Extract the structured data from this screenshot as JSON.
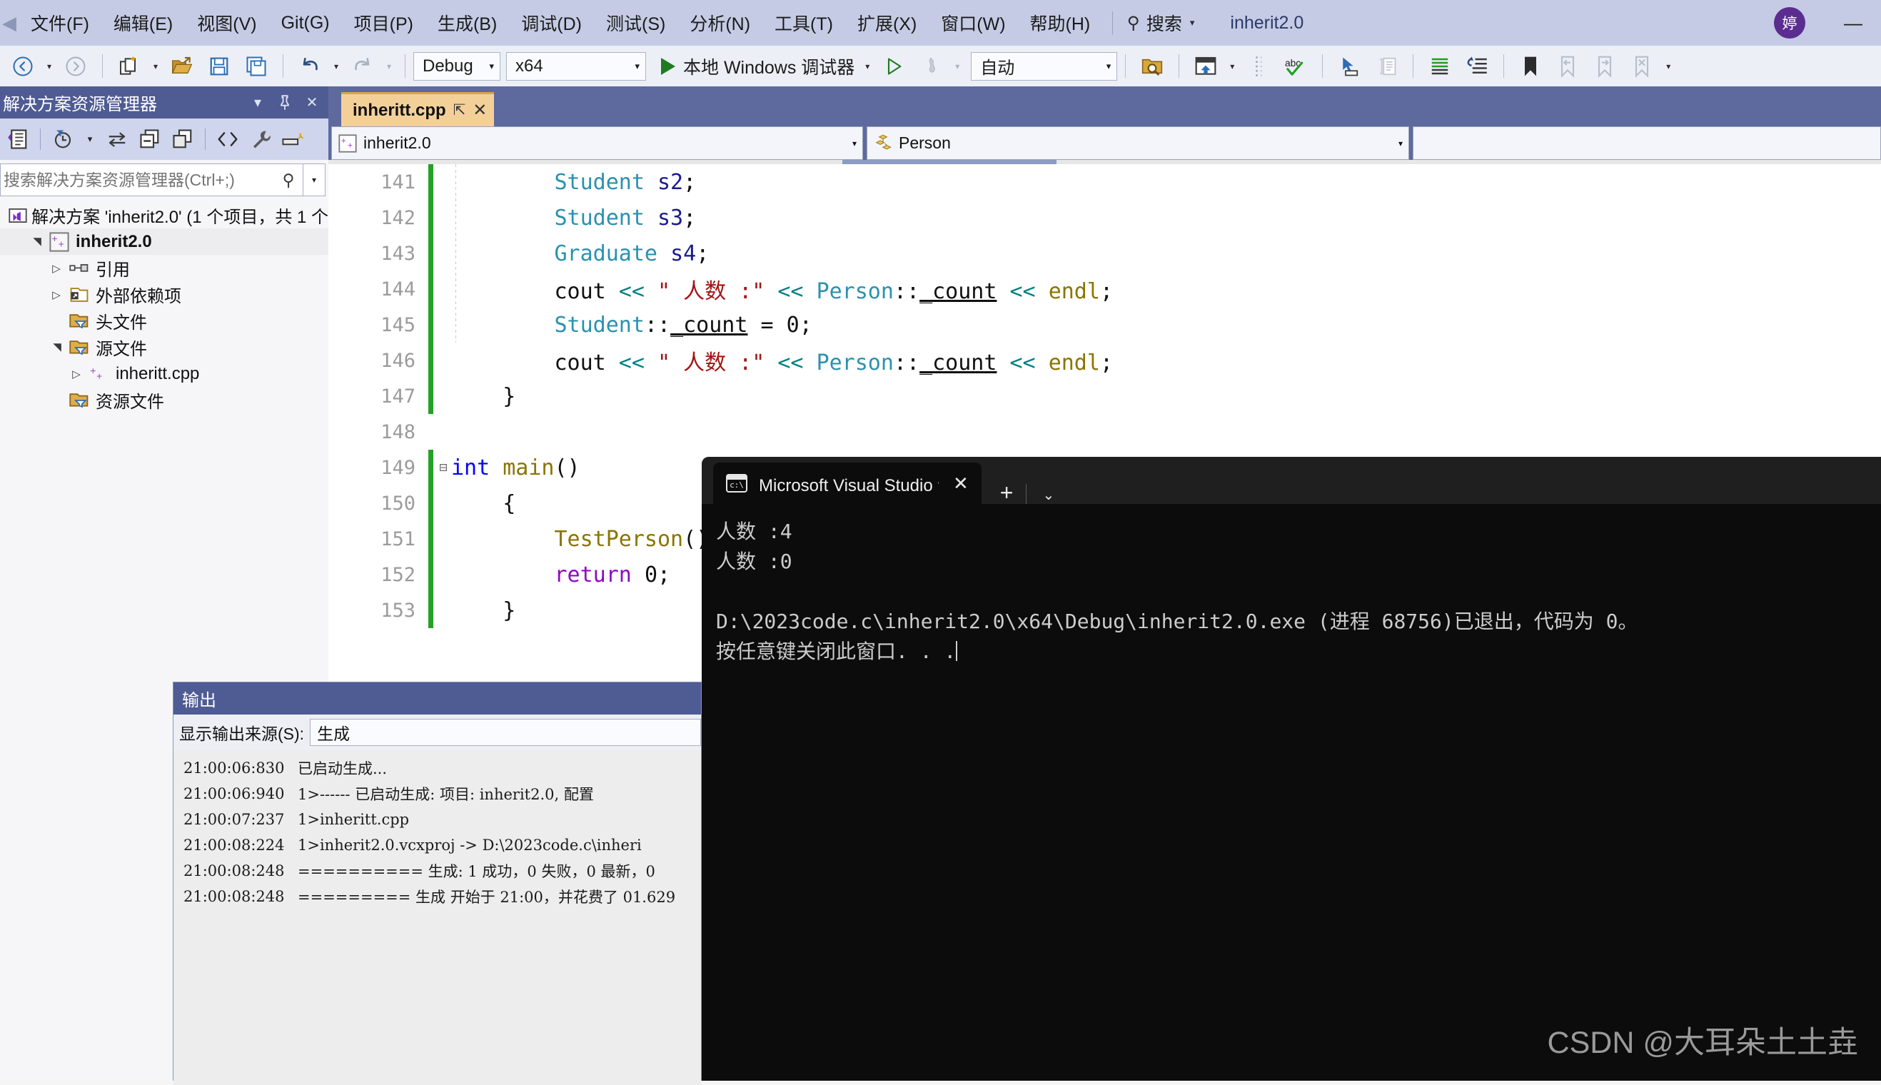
{
  "menubar": {
    "items": [
      "文件(F)",
      "编辑(E)",
      "视图(V)",
      "Git(G)",
      "项目(P)",
      "生成(B)",
      "调试(D)",
      "测试(S)",
      "分析(N)",
      "工具(T)",
      "扩展(X)",
      "窗口(W)",
      "帮助(H)"
    ],
    "search_label": "搜索",
    "search_caret": "▾",
    "solution_title": "inherit2.0",
    "avatar_initial": "婷",
    "minimize": "—"
  },
  "toolbar": {
    "nav_back": "◀",
    "nav_forward": "▶",
    "caret": "▾",
    "config": "Debug",
    "platform": "x64",
    "run_label": "本地 Windows 调试器",
    "auto": "自动",
    "icons": {
      "new_item": "new-item-icon",
      "open_file": "open-file-icon",
      "save": "save-icon",
      "save_all": "save-all-icon",
      "undo": "undo-icon",
      "redo": "redo-icon",
      "attach": "attach-to-process-icon",
      "solution_find": "find-in-solution-icon",
      "window_layout": "window-layout-icon",
      "spell": "abc",
      "pointer": "pointer-icon",
      "comment": "comment-icon",
      "indent": "indent-icon",
      "outdent": "outdent-icon",
      "bookmark": "bookmark-icon"
    }
  },
  "solution_explorer": {
    "title": "解决方案资源管理器",
    "header_buttons": [
      "▾",
      "⚲",
      "✕"
    ],
    "search_placeholder": "搜索解决方案资源管理器(Ctrl+;)",
    "search_value": "",
    "tree": [
      {
        "indent": 0,
        "arrow": "",
        "icon": "solution-icon",
        "label": "解决方案 'inherit2.0' (1 个项目，共 1 个",
        "bold": false,
        "selected": false
      },
      {
        "indent": 1,
        "arrow": "▲",
        "icon": "cpp-project-icon",
        "label": "inherit2.0",
        "bold": true,
        "selected": true
      },
      {
        "indent": 2,
        "arrow": "▷",
        "icon": "references-icon",
        "label": "引用",
        "bold": false,
        "selected": false
      },
      {
        "indent": 2,
        "arrow": "▷",
        "icon": "external-deps-icon",
        "label": "外部依赖项",
        "bold": false,
        "selected": false
      },
      {
        "indent": 2,
        "arrow": "",
        "icon": "filter-folder-icon",
        "label": "头文件",
        "bold": false,
        "selected": false
      },
      {
        "indent": 2,
        "arrow": "▲",
        "icon": "filter-folder-icon",
        "label": "源文件",
        "bold": false,
        "selected": false
      },
      {
        "indent": 3,
        "arrow": "▷",
        "icon": "cpp-file-icon",
        "label": "inheritt.cpp",
        "bold": false,
        "selected": false
      },
      {
        "indent": 2,
        "arrow": "",
        "icon": "filter-folder-icon",
        "label": "资源文件",
        "bold": false,
        "selected": false
      }
    ]
  },
  "editor": {
    "tab_name": "inheritt.cpp",
    "tab_pin": "⇱",
    "tab_close": "✕",
    "nav_project": "inherit2.0",
    "nav_class": "Person",
    "nav_member": "",
    "caret": "▾",
    "lines": [
      {
        "num": "141",
        "changed": true,
        "fold": "",
        "tokens": [
          {
            "t": "        ",
            "c": "t-id"
          },
          {
            "t": "Student",
            "c": "t-type"
          },
          {
            "t": " ",
            "c": "t-id"
          },
          {
            "t": "s2",
            "c": "t-var"
          },
          {
            "t": ";",
            "c": "t-id"
          }
        ]
      },
      {
        "num": "142",
        "changed": true,
        "fold": "",
        "tokens": [
          {
            "t": "        ",
            "c": "t-id"
          },
          {
            "t": "Student",
            "c": "t-type"
          },
          {
            "t": " ",
            "c": "t-id"
          },
          {
            "t": "s3",
            "c": "t-var"
          },
          {
            "t": ";",
            "c": "t-id"
          }
        ]
      },
      {
        "num": "143",
        "changed": true,
        "fold": "",
        "tokens": [
          {
            "t": "        ",
            "c": "t-id"
          },
          {
            "t": "Graduate",
            "c": "t-type"
          },
          {
            "t": " ",
            "c": "t-id"
          },
          {
            "t": "s4",
            "c": "t-var"
          },
          {
            "t": ";",
            "c": "t-id"
          }
        ]
      },
      {
        "num": "144",
        "changed": true,
        "fold": "",
        "tokens": [
          {
            "t": "        ",
            "c": "t-id"
          },
          {
            "t": "cout",
            "c": "t-id"
          },
          {
            "t": " ",
            "c": "t-id"
          },
          {
            "t": "<<",
            "c": "t-op"
          },
          {
            "t": " ",
            "c": "t-id"
          },
          {
            "t": "\" 人数 :\"",
            "c": "t-str"
          },
          {
            "t": " ",
            "c": "t-id"
          },
          {
            "t": "<<",
            "c": "t-op"
          },
          {
            "t": " ",
            "c": "t-id"
          },
          {
            "t": "Person",
            "c": "t-type"
          },
          {
            "t": "::",
            "c": "t-id"
          },
          {
            "t": "_count",
            "c": "t-ident-u"
          },
          {
            "t": " ",
            "c": "t-id"
          },
          {
            "t": "<<",
            "c": "t-op"
          },
          {
            "t": " ",
            "c": "t-id"
          },
          {
            "t": "endl",
            "c": "t-endl"
          },
          {
            "t": ";",
            "c": "t-id"
          }
        ]
      },
      {
        "num": "145",
        "changed": true,
        "fold": "",
        "tokens": [
          {
            "t": "        ",
            "c": "t-id"
          },
          {
            "t": "Student",
            "c": "t-type"
          },
          {
            "t": "::",
            "c": "t-id"
          },
          {
            "t": "_count",
            "c": "t-ident-u"
          },
          {
            "t": " = ",
            "c": "t-id"
          },
          {
            "t": "0",
            "c": "t-num"
          },
          {
            "t": ";",
            "c": "t-id"
          }
        ]
      },
      {
        "num": "146",
        "changed": true,
        "fold": "",
        "tokens": [
          {
            "t": "        ",
            "c": "t-id"
          },
          {
            "t": "cout",
            "c": "t-id"
          },
          {
            "t": " ",
            "c": "t-id"
          },
          {
            "t": "<<",
            "c": "t-op"
          },
          {
            "t": " ",
            "c": "t-id"
          },
          {
            "t": "\" 人数 :\"",
            "c": "t-str"
          },
          {
            "t": " ",
            "c": "t-id"
          },
          {
            "t": "<<",
            "c": "t-op"
          },
          {
            "t": " ",
            "c": "t-id"
          },
          {
            "t": "Person",
            "c": "t-type"
          },
          {
            "t": "::",
            "c": "t-id"
          },
          {
            "t": "_count",
            "c": "t-ident-u"
          },
          {
            "t": " ",
            "c": "t-id"
          },
          {
            "t": "<<",
            "c": "t-op"
          },
          {
            "t": " ",
            "c": "t-id"
          },
          {
            "t": "endl",
            "c": "t-endl"
          },
          {
            "t": ";",
            "c": "t-id"
          }
        ]
      },
      {
        "num": "147",
        "changed": true,
        "fold": "",
        "tokens": [
          {
            "t": "    ",
            "c": "t-id"
          },
          {
            "t": "}",
            "c": "t-id"
          }
        ]
      },
      {
        "num": "148",
        "changed": false,
        "fold": "",
        "tokens": []
      },
      {
        "num": "149",
        "changed": true,
        "fold": "⊟",
        "tokens": [
          {
            "t": "int",
            "c": "t-kw"
          },
          {
            "t": " ",
            "c": "t-id"
          },
          {
            "t": "main",
            "c": "t-fn"
          },
          {
            "t": "()",
            "c": "t-id"
          }
        ]
      },
      {
        "num": "150",
        "changed": true,
        "fold": "",
        "tokens": [
          {
            "t": "    ",
            "c": "t-id"
          },
          {
            "t": "{",
            "c": "t-id"
          }
        ]
      },
      {
        "num": "151",
        "changed": true,
        "fold": "",
        "tokens": [
          {
            "t": "        ",
            "c": "t-id"
          },
          {
            "t": "TestPerson",
            "c": "t-fn"
          },
          {
            "t": "();",
            "c": "t-id"
          }
        ]
      },
      {
        "num": "152",
        "changed": true,
        "fold": "",
        "tokens": [
          {
            "t": "        ",
            "c": "t-id"
          },
          {
            "t": "return",
            "c": "t-kw2"
          },
          {
            "t": " ",
            "c": "t-id"
          },
          {
            "t": "0",
            "c": "t-num"
          },
          {
            "t": ";",
            "c": "t-id"
          }
        ]
      },
      {
        "num": "153",
        "changed": true,
        "fold": "",
        "tokens": [
          {
            "t": "    ",
            "c": "t-id"
          },
          {
            "t": "}",
            "c": "t-id"
          }
        ]
      }
    ]
  },
  "output_window": {
    "title": "输出",
    "source_label": "显示输出来源(S):",
    "source_value": "生成",
    "rows": [
      {
        "time": "21:00:06:830",
        "msg": "已启动生成..."
      },
      {
        "time": "21:00:06:940",
        "msg": "1>------ 已启动生成: 项目: inherit2.0, 配置"
      },
      {
        "time": "21:00:07:237",
        "msg": "1>inheritt.cpp"
      },
      {
        "time": "21:00:08:224",
        "msg": "1>inherit2.0.vcxproj -> D:\\2023code.c\\inheri"
      },
      {
        "time": "21:00:08:248",
        "msg": "========== 生成: 1 成功，0 失败，0 最新，0 "
      },
      {
        "time": "21:00:08:248",
        "msg": "========= 生成 开始于 21:00，并花费了 01.629"
      }
    ]
  },
  "console": {
    "tab_title": "Microsoft Visual Studio 调试控",
    "tab_close": "✕",
    "new_tab": "+",
    "dropdown": "⌄",
    "icon_text": "c:\\",
    "lines": [
      "人数 :4",
      "人数 :0",
      "",
      "D:\\2023code.c\\inherit2.0\\x64\\Debug\\inherit2.0.exe (进程 68756)已退出，代码为 0。",
      "按任意键关闭此窗口. . ."
    ]
  },
  "watermark": "CSDN @大耳朵土土垚",
  "colors": {
    "menubar_bg": "#C5CBE4",
    "toolbar_bg": "#EDEFF7",
    "panel_header": "#4F5B93",
    "editor_chrome": "#5E6A9E",
    "active_tab": "#F4D099",
    "console_bg": "#0C0C0C",
    "avatar": "#5B2D90",
    "change_bar": "#25A025"
  }
}
